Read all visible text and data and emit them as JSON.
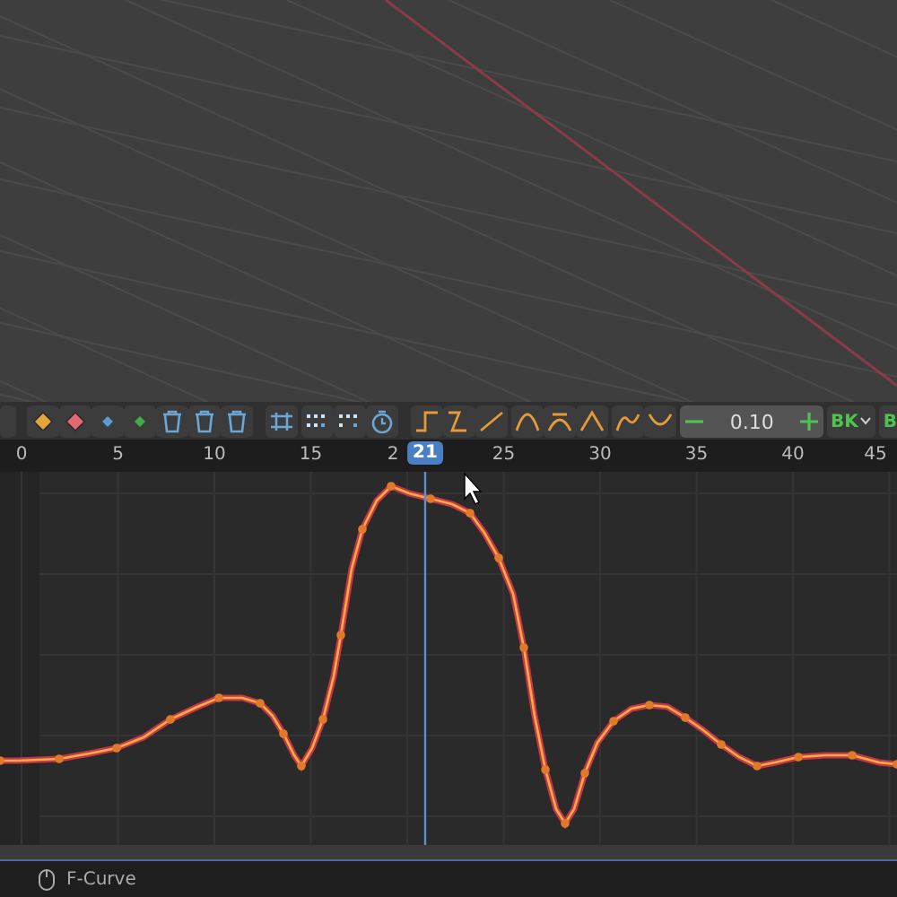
{
  "toolbar": {
    "step_field": {
      "value": "0.10"
    },
    "keying_set": {
      "label": "BK"
    },
    "cut_button": {
      "label": "B"
    }
  },
  "ruler": {
    "labels": [
      "0",
      "5",
      "10",
      "15",
      "2",
      "25",
      "30",
      "35",
      "40",
      "45"
    ],
    "current_frame": "21"
  },
  "status_bar": {
    "mode": "F-Curve"
  }
}
